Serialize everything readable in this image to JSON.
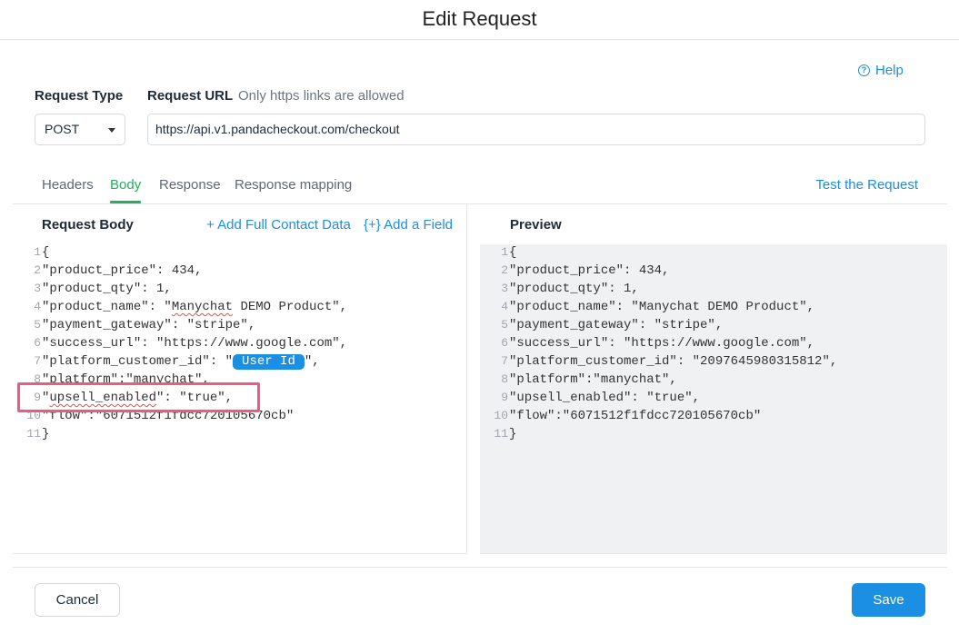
{
  "dialog": {
    "title": "Edit Request"
  },
  "help": {
    "label": "Help",
    "icon": "question-circle-icon"
  },
  "form": {
    "request_type_label": "Request Type",
    "request_type_value": "POST",
    "request_url_label": "Request URL",
    "request_url_hint": "Only https links are allowed",
    "request_url_value": "https://api.v1.pandacheckout.com/checkout"
  },
  "tabs": [
    {
      "label": "Headers",
      "active": false
    },
    {
      "label": "Body",
      "active": true
    },
    {
      "label": "Response",
      "active": false
    },
    {
      "label": "Response mapping",
      "active": false
    }
  ],
  "test_request_label": "Test the Request",
  "body_editor": {
    "title": "Request Body",
    "add_contact_label": "+ Add Full Contact Data",
    "add_field_label": "{+} Add a Field",
    "lines": [
      {
        "n": "1",
        "parts": [
          {
            "t": "{"
          }
        ]
      },
      {
        "n": "2",
        "parts": [
          {
            "t": "\"product_price\": 434,"
          }
        ]
      },
      {
        "n": "3",
        "parts": [
          {
            "t": "\"product_qty\": 1,"
          }
        ]
      },
      {
        "n": "4",
        "parts": [
          {
            "t": "\"product_name\": \""
          },
          {
            "t": "Manychat",
            "spell": true
          },
          {
            "t": " DEMO Product\","
          }
        ]
      },
      {
        "n": "5",
        "parts": [
          {
            "t": "\"payment_gateway\": \"stripe\","
          }
        ]
      },
      {
        "n": "6",
        "parts": [
          {
            "t": "\"success_url\": \"https://www.google.com\","
          }
        ]
      },
      {
        "n": "7",
        "parts": [
          {
            "t": "\"platform_customer_id\": \""
          },
          {
            "t": "User Id",
            "pill": true
          },
          {
            "t": "\","
          }
        ]
      },
      {
        "n": "8",
        "parts": [
          {
            "t": "\"platform\":\"manychat\","
          }
        ]
      },
      {
        "n": "9",
        "parts": [
          {
            "t": "\""
          },
          {
            "t": "upsell_enabled",
            "spell": true
          },
          {
            "t": "\": \"true\","
          }
        ]
      },
      {
        "n": "10",
        "parts": [
          {
            "t": "\"flow\":\"6071512f1fdcc720105670cb\""
          }
        ]
      },
      {
        "n": "11",
        "parts": [
          {
            "t": "}"
          }
        ]
      }
    ]
  },
  "preview": {
    "title": "Preview",
    "lines": [
      {
        "n": "1",
        "text": "{"
      },
      {
        "n": "2",
        "text": "\"product_price\": 434,"
      },
      {
        "n": "3",
        "text": "\"product_qty\": 1,"
      },
      {
        "n": "4",
        "text": "\"product_name\": \"Manychat DEMO Product\","
      },
      {
        "n": "5",
        "text": "\"payment_gateway\": \"stripe\","
      },
      {
        "n": "6",
        "text": "\"success_url\": \"https://www.google.com\","
      },
      {
        "n": "7",
        "text": "\"platform_customer_id\": \"2097645980315812\","
      },
      {
        "n": "8",
        "text": "\"platform\":\"manychat\","
      },
      {
        "n": "9",
        "text": "\"upsell_enabled\": \"true\","
      },
      {
        "n": "10",
        "text": "\"flow\":\"6071512f1fdcc720105670cb\""
      },
      {
        "n": "11",
        "text": "}"
      }
    ]
  },
  "footer": {
    "cancel_label": "Cancel",
    "save_label": "Save"
  },
  "colors": {
    "accent": "#1a8fe3",
    "tab_active": "#27ae60",
    "highlight": "#ec5a86",
    "preview_bg": "#f0f1f3"
  }
}
